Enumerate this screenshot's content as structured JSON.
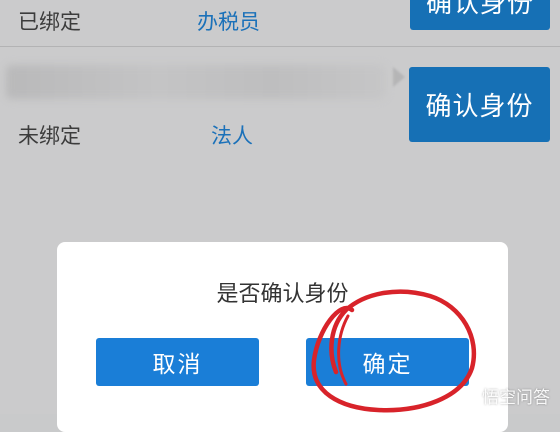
{
  "rows": [
    {
      "status": "已绑定",
      "role": "办税员",
      "button_label": "确认身份"
    },
    {
      "status": "未绑定",
      "role": "法人",
      "button_label": "确认身份"
    }
  ],
  "dialog": {
    "title": "是否确认身份",
    "cancel_label": "取消",
    "confirm_label": "确定"
  },
  "annotation": {
    "circle_color": "#d8232a"
  },
  "watermark": {
    "text": "悟空问答"
  },
  "colors": {
    "primary_button": "#1670b5",
    "dialog_button": "#1a7ed7",
    "role_text": "#1b71b9"
  }
}
